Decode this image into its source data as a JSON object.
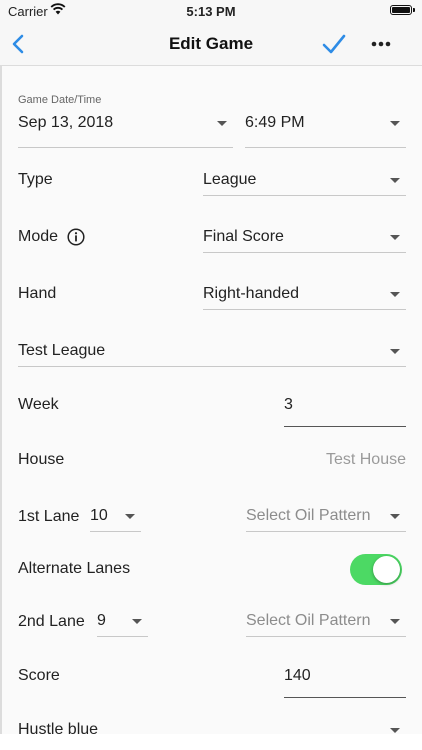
{
  "status_bar": {
    "carrier": "Carrier",
    "time": "5:13 PM"
  },
  "nav": {
    "title": "Edit Game",
    "accent_color": "#2e8ce6"
  },
  "form": {
    "date_label": "Game Date/Time",
    "date_value": "Sep 13, 2018",
    "time_value": "6:49 PM",
    "type_label": "Type",
    "type_value": "League",
    "mode_label": "Mode",
    "mode_value": "Final Score",
    "hand_label": "Hand",
    "hand_value": "Right-handed",
    "league_value": "Test League",
    "week_label": "Week",
    "week_value": "3",
    "house_label": "House",
    "house_value": "Test House",
    "lane1_label": "1st Lane",
    "lane1_value": "10",
    "oil1_placeholder": "Select Oil Pattern",
    "alternate_label": "Alternate Lanes",
    "alternate_on": true,
    "lane2_label": "2nd Lane",
    "lane2_value": "9",
    "oil2_placeholder": "Select Oil Pattern",
    "score_label": "Score",
    "score_value": "140",
    "ball_value": "Hustle blue"
  }
}
